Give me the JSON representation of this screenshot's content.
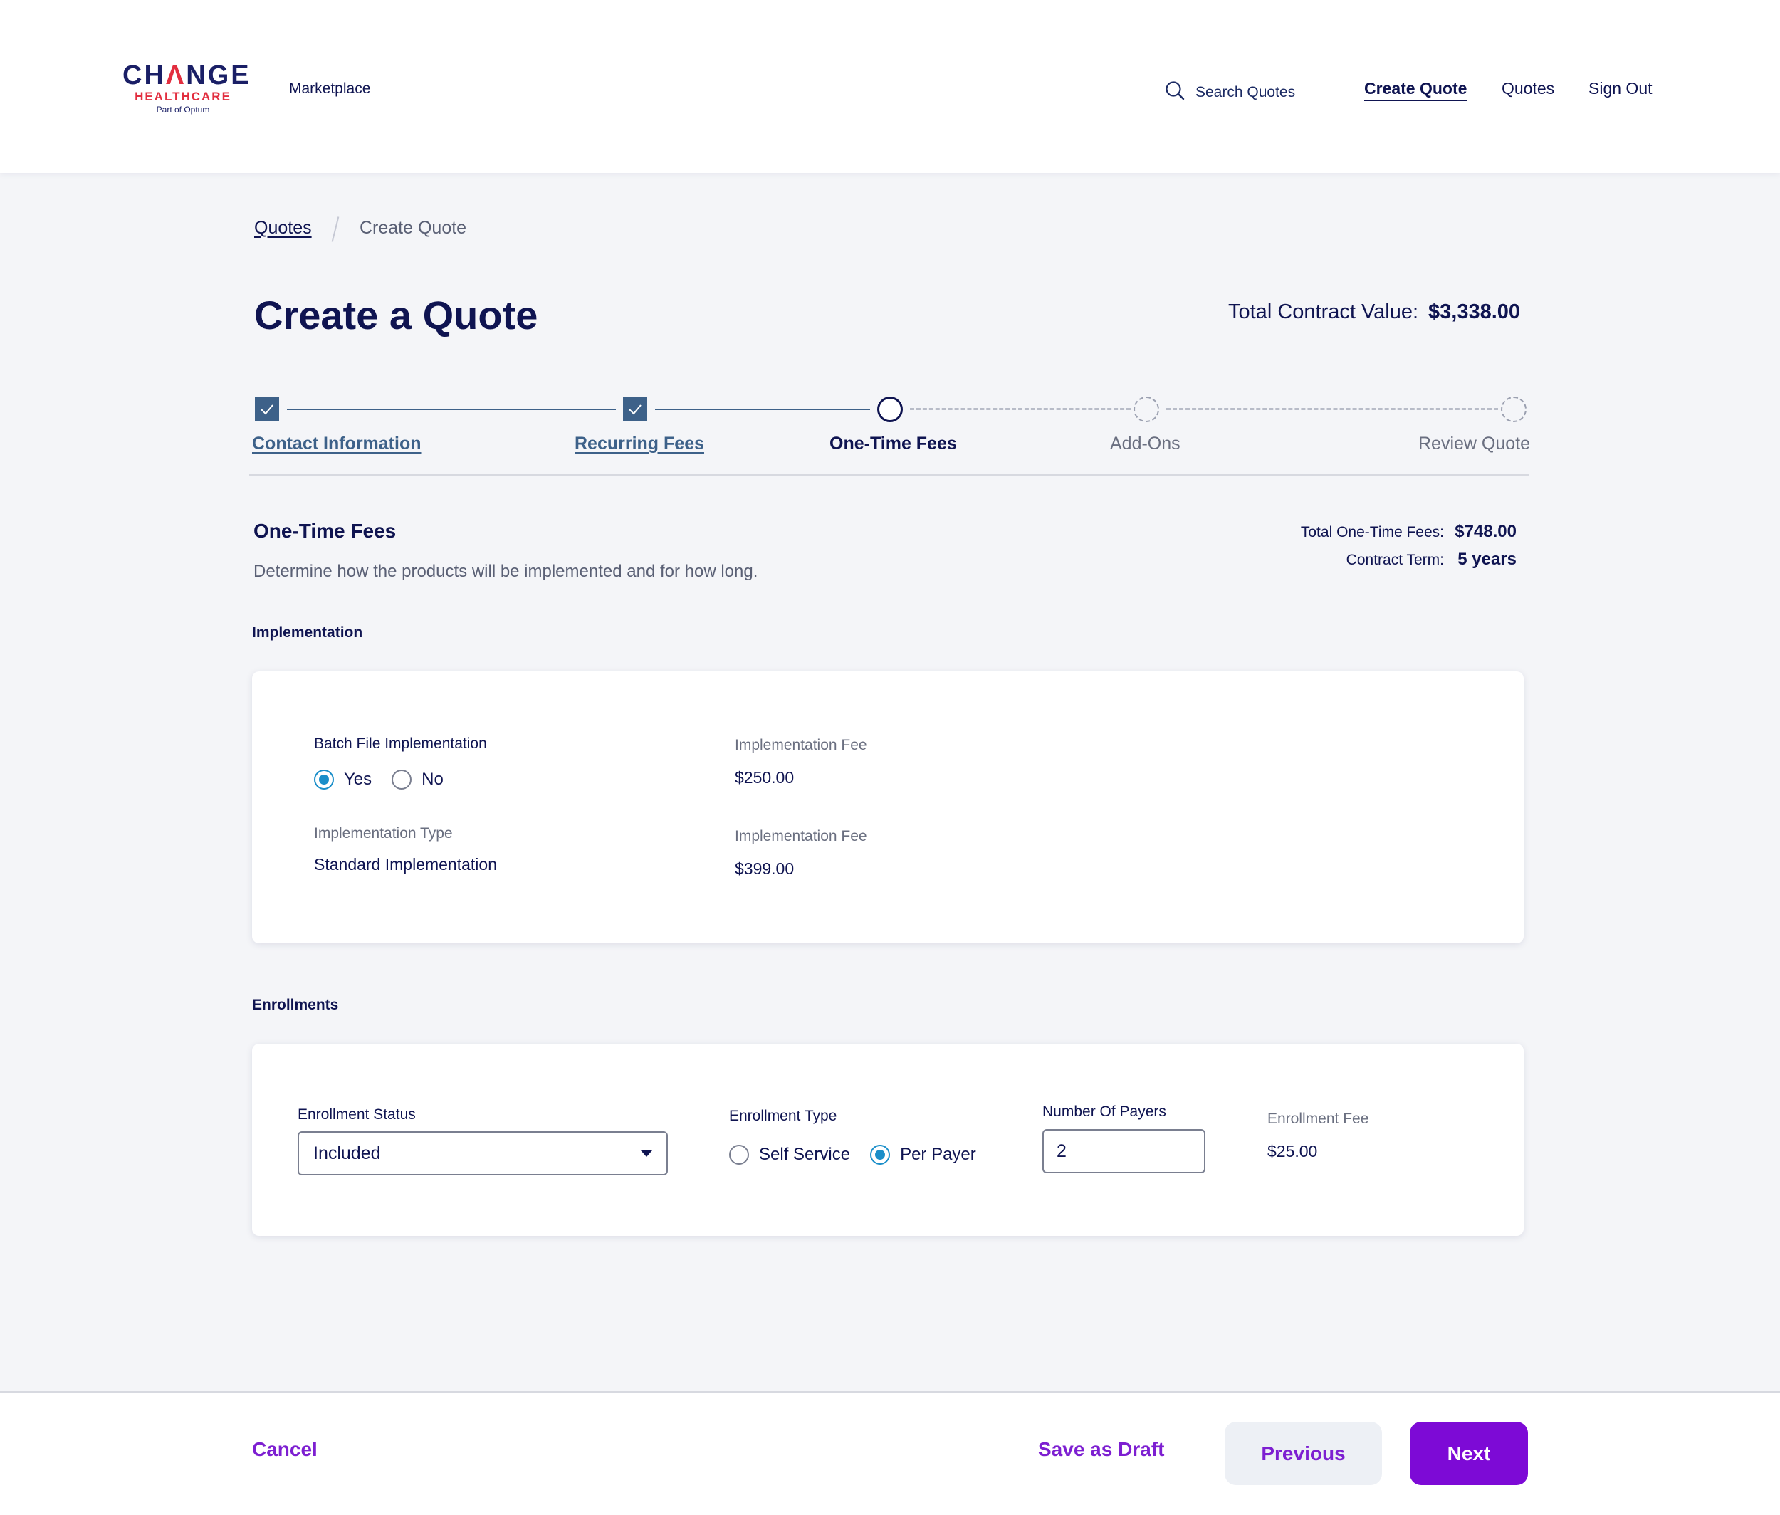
{
  "header": {
    "logo": {
      "main": "CHANGE",
      "sub": "HEALTHCARE",
      "tagline": "Part of Optum"
    },
    "marketplace_label": "Marketplace",
    "search_label": "Search Quotes",
    "nav": {
      "create_quote": "Create Quote",
      "quotes": "Quotes",
      "sign_out": "Sign Out"
    }
  },
  "breadcrumb": {
    "parent": "Quotes",
    "current": "Create Quote"
  },
  "page": {
    "title": "Create a Quote",
    "total_contract_label": "Total Contract Value:",
    "total_contract_value": "$3,338.00"
  },
  "stepper": {
    "steps": [
      {
        "label": "Contact Information",
        "state": "complete"
      },
      {
        "label": "Recurring Fees",
        "state": "complete"
      },
      {
        "label": "One-Time Fees",
        "state": "current"
      },
      {
        "label": "Add-Ons",
        "state": "upcoming"
      },
      {
        "label": "Review Quote",
        "state": "upcoming"
      }
    ]
  },
  "section": {
    "title": "One-Time Fees",
    "description": "Determine how the products will be implemented and for how long.",
    "total_fees_label": "Total One-Time Fees:",
    "total_fees_value": "$748.00",
    "contract_term_label": "Contract Term:",
    "contract_term_value": "5 years"
  },
  "implementation": {
    "group_label": "Implementation",
    "batch_label": "Batch File Implementation",
    "batch_options": {
      "yes": "Yes",
      "no": "No",
      "selected": "yes"
    },
    "fee1_label": "Implementation Fee",
    "fee1_value": "$250.00",
    "type_label": "Implementation Type",
    "type_value": "Standard Implementation",
    "fee2_label": "Implementation Fee",
    "fee2_value": "$399.00"
  },
  "enrollments": {
    "group_label": "Enrollments",
    "status_label": "Enrollment Status",
    "status_value": "Included",
    "type_label": "Enrollment Type",
    "type_options": {
      "self": "Self Service",
      "per_payer": "Per Payer",
      "selected": "per_payer"
    },
    "payers_label": "Number Of Payers",
    "payers_value": "2",
    "fee_label": "Enrollment Fee",
    "fee_value": "$25.00"
  },
  "footer": {
    "cancel": "Cancel",
    "save_draft": "Save as Draft",
    "previous": "Previous",
    "next": "Next"
  },
  "colors": {
    "navy": "#0f1451",
    "step_complete": "#3d6189",
    "radio_selected": "#1a8ec9",
    "brand_purple": "#7d0ad6",
    "brand_red": "#e22e3f"
  }
}
